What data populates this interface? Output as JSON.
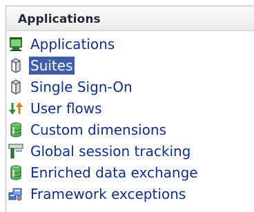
{
  "panel": {
    "title": "Applications"
  },
  "items": [
    {
      "label": "Applications",
      "icon": "application-window-icon",
      "selected": false
    },
    {
      "label": "Suites",
      "icon": "cylinder-icon",
      "selected": true
    },
    {
      "label": "Single Sign-On",
      "icon": "cylinder-icon",
      "selected": false
    },
    {
      "label": "User flows",
      "icon": "flow-arrows-icon",
      "selected": false
    },
    {
      "label": "Custom dimensions",
      "icon": "database-icon",
      "selected": false
    },
    {
      "label": "Global session tracking",
      "icon": "session-tracking-icon",
      "selected": false
    },
    {
      "label": "Enriched data exchange",
      "icon": "database-icon",
      "selected": false
    },
    {
      "label": "Framework exceptions",
      "icon": "framework-icon",
      "selected": false
    }
  ],
  "colors": {
    "link": "#0f2f8f",
    "selected_bg": "#3f5da8",
    "selected_text": "#ffffff"
  }
}
